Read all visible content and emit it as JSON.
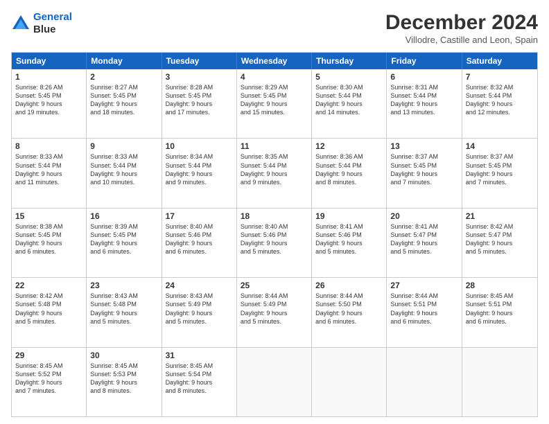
{
  "logo": {
    "line1": "General",
    "line2": "Blue"
  },
  "title": "December 2024",
  "location": "Villodre, Castille and Leon, Spain",
  "header_days": [
    "Sunday",
    "Monday",
    "Tuesday",
    "Wednesday",
    "Thursday",
    "Friday",
    "Saturday"
  ],
  "weeks": [
    [
      {
        "day": "1",
        "info": "Sunrise: 8:26 AM\nSunset: 5:45 PM\nDaylight: 9 hours\nand 19 minutes."
      },
      {
        "day": "2",
        "info": "Sunrise: 8:27 AM\nSunset: 5:45 PM\nDaylight: 9 hours\nand 18 minutes."
      },
      {
        "day": "3",
        "info": "Sunrise: 8:28 AM\nSunset: 5:45 PM\nDaylight: 9 hours\nand 17 minutes."
      },
      {
        "day": "4",
        "info": "Sunrise: 8:29 AM\nSunset: 5:45 PM\nDaylight: 9 hours\nand 15 minutes."
      },
      {
        "day": "5",
        "info": "Sunrise: 8:30 AM\nSunset: 5:44 PM\nDaylight: 9 hours\nand 14 minutes."
      },
      {
        "day": "6",
        "info": "Sunrise: 8:31 AM\nSunset: 5:44 PM\nDaylight: 9 hours\nand 13 minutes."
      },
      {
        "day": "7",
        "info": "Sunrise: 8:32 AM\nSunset: 5:44 PM\nDaylight: 9 hours\nand 12 minutes."
      }
    ],
    [
      {
        "day": "8",
        "info": "Sunrise: 8:33 AM\nSunset: 5:44 PM\nDaylight: 9 hours\nand 11 minutes."
      },
      {
        "day": "9",
        "info": "Sunrise: 8:33 AM\nSunset: 5:44 PM\nDaylight: 9 hours\nand 10 minutes."
      },
      {
        "day": "10",
        "info": "Sunrise: 8:34 AM\nSunset: 5:44 PM\nDaylight: 9 hours\nand 9 minutes."
      },
      {
        "day": "11",
        "info": "Sunrise: 8:35 AM\nSunset: 5:44 PM\nDaylight: 9 hours\nand 9 minutes."
      },
      {
        "day": "12",
        "info": "Sunrise: 8:36 AM\nSunset: 5:44 PM\nDaylight: 9 hours\nand 8 minutes."
      },
      {
        "day": "13",
        "info": "Sunrise: 8:37 AM\nSunset: 5:45 PM\nDaylight: 9 hours\nand 7 minutes."
      },
      {
        "day": "14",
        "info": "Sunrise: 8:37 AM\nSunset: 5:45 PM\nDaylight: 9 hours\nand 7 minutes."
      }
    ],
    [
      {
        "day": "15",
        "info": "Sunrise: 8:38 AM\nSunset: 5:45 PM\nDaylight: 9 hours\nand 6 minutes."
      },
      {
        "day": "16",
        "info": "Sunrise: 8:39 AM\nSunset: 5:45 PM\nDaylight: 9 hours\nand 6 minutes."
      },
      {
        "day": "17",
        "info": "Sunrise: 8:40 AM\nSunset: 5:46 PM\nDaylight: 9 hours\nand 6 minutes."
      },
      {
        "day": "18",
        "info": "Sunrise: 8:40 AM\nSunset: 5:46 PM\nDaylight: 9 hours\nand 5 minutes."
      },
      {
        "day": "19",
        "info": "Sunrise: 8:41 AM\nSunset: 5:46 PM\nDaylight: 9 hours\nand 5 minutes."
      },
      {
        "day": "20",
        "info": "Sunrise: 8:41 AM\nSunset: 5:47 PM\nDaylight: 9 hours\nand 5 minutes."
      },
      {
        "day": "21",
        "info": "Sunrise: 8:42 AM\nSunset: 5:47 PM\nDaylight: 9 hours\nand 5 minutes."
      }
    ],
    [
      {
        "day": "22",
        "info": "Sunrise: 8:42 AM\nSunset: 5:48 PM\nDaylight: 9 hours\nand 5 minutes."
      },
      {
        "day": "23",
        "info": "Sunrise: 8:43 AM\nSunset: 5:48 PM\nDaylight: 9 hours\nand 5 minutes."
      },
      {
        "day": "24",
        "info": "Sunrise: 8:43 AM\nSunset: 5:49 PM\nDaylight: 9 hours\nand 5 minutes."
      },
      {
        "day": "25",
        "info": "Sunrise: 8:44 AM\nSunset: 5:49 PM\nDaylight: 9 hours\nand 5 minutes."
      },
      {
        "day": "26",
        "info": "Sunrise: 8:44 AM\nSunset: 5:50 PM\nDaylight: 9 hours\nand 6 minutes."
      },
      {
        "day": "27",
        "info": "Sunrise: 8:44 AM\nSunset: 5:51 PM\nDaylight: 9 hours\nand 6 minutes."
      },
      {
        "day": "28",
        "info": "Sunrise: 8:45 AM\nSunset: 5:51 PM\nDaylight: 9 hours\nand 6 minutes."
      }
    ],
    [
      {
        "day": "29",
        "info": "Sunrise: 8:45 AM\nSunset: 5:52 PM\nDaylight: 9 hours\nand 7 minutes."
      },
      {
        "day": "30",
        "info": "Sunrise: 8:45 AM\nSunset: 5:53 PM\nDaylight: 9 hours\nand 8 minutes."
      },
      {
        "day": "31",
        "info": "Sunrise: 8:45 AM\nSunset: 5:54 PM\nDaylight: 9 hours\nand 8 minutes."
      },
      {
        "day": "",
        "info": ""
      },
      {
        "day": "",
        "info": ""
      },
      {
        "day": "",
        "info": ""
      },
      {
        "day": "",
        "info": ""
      }
    ]
  ]
}
